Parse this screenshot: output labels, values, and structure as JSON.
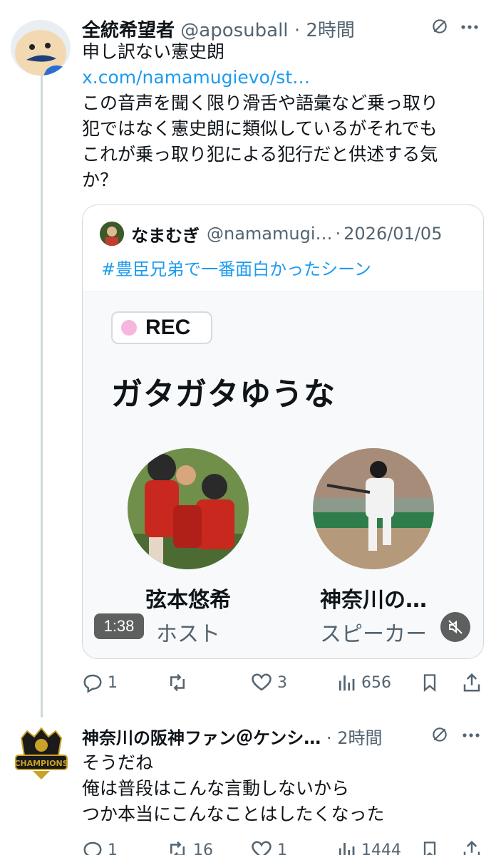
{
  "tweet1": {
    "display_name": "全統希望者",
    "handle": "@aposuball",
    "time": "2時間",
    "lines": [
      "申し訳ない憲史朗"
    ],
    "link": "x.com/namamugievo/st…",
    "body_lines": [
      "この音声を聞く限り滑舌や語彙など乗っ取り",
      "犯ではなく憲史朗に類似しているがそれでも",
      "これが乗っ取り犯による犯行だと供述する気",
      "か？"
    ],
    "quote": {
      "display_name": "なまむぎ",
      "handle": "@namamugi…",
      "date": "2026/01/05",
      "hashtag": "#豊臣兄弟で一番面白かったシーン",
      "space": {
        "rec_label": "REC",
        "title": "ガタガタゆうな",
        "host_name": "弦本悠希",
        "host_role": "ホスト",
        "speaker_name": "神奈川の…",
        "speaker_role": "スピーカー",
        "duration": "1:38"
      }
    },
    "actions": {
      "replies": "1",
      "reposts": "",
      "likes": "3",
      "views": "656"
    }
  },
  "tweet2": {
    "display_name": "神奈川の阪神ファン＠ケンシ…",
    "time": "2時間",
    "body_lines": [
      "そうだね",
      "俺は普段はこんな言動しないから",
      "つか本当にこんなことはしたくなった"
    ],
    "actions": {
      "replies": "1",
      "reposts": "16",
      "likes": "1",
      "views": "1444"
    }
  },
  "colors": {
    "link": "#1d9bf0",
    "secondary": "#536471",
    "border": "#cfd9de",
    "rec_dot": "#f7b6dd"
  },
  "icons": [
    "reply-icon",
    "repost-icon",
    "like-icon",
    "views-icon",
    "bookmark-icon",
    "share-icon",
    "grok-icon",
    "more-icon",
    "mute-icon"
  ]
}
